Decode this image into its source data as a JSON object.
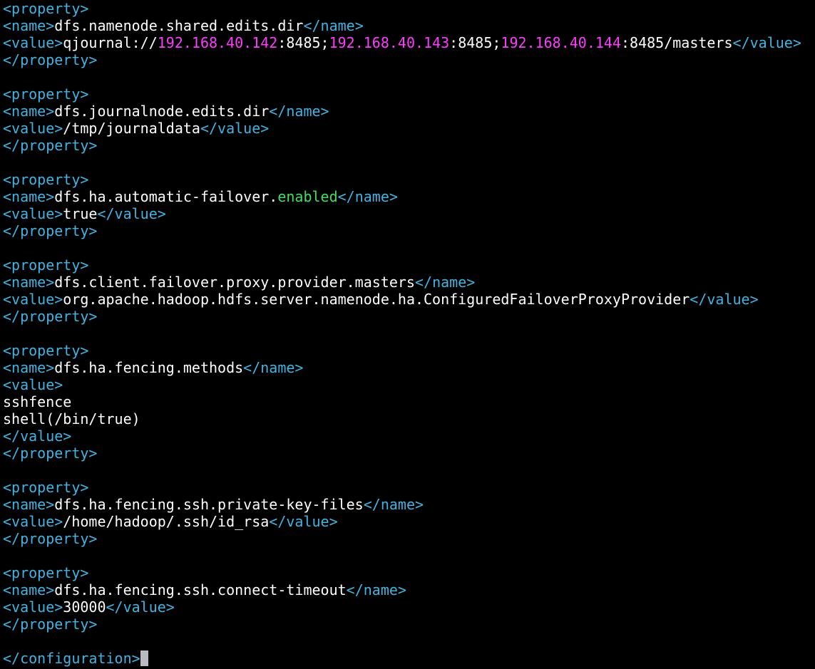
{
  "colors": {
    "background": "#000000",
    "text": "#ffffff",
    "tag": "#3fb4e3",
    "ip": "#ff3bff",
    "keyword": "#3fe05f",
    "cursor": "#b9b9c4"
  },
  "lines": [
    [
      {
        "t": "<property>",
        "k": "tag"
      }
    ],
    [
      {
        "t": "<name>",
        "k": "tag"
      },
      {
        "t": "dfs.namenode.shared.edits.dir",
        "k": "text"
      },
      {
        "t": "</name>",
        "k": "tag"
      }
    ],
    [
      {
        "t": "<value>",
        "k": "tag"
      },
      {
        "t": "qjournal://",
        "k": "text"
      },
      {
        "t": "192.168.40.142",
        "k": "ip"
      },
      {
        "t": ":8485;",
        "k": "text"
      },
      {
        "t": "192.168.40.143",
        "k": "ip"
      },
      {
        "t": ":8485;",
        "k": "text"
      },
      {
        "t": "192.168.40.144",
        "k": "ip"
      },
      {
        "t": ":8485/masters",
        "k": "text"
      },
      {
        "t": "</value>",
        "k": "tag"
      }
    ],
    [
      {
        "t": "</property>",
        "k": "tag"
      }
    ],
    [],
    [
      {
        "t": "<property>",
        "k": "tag"
      }
    ],
    [
      {
        "t": "<name>",
        "k": "tag"
      },
      {
        "t": "dfs.journalnode.edits.dir",
        "k": "text"
      },
      {
        "t": "</name>",
        "k": "tag"
      }
    ],
    [
      {
        "t": "<value>",
        "k": "tag"
      },
      {
        "t": "/tmp/journaldata",
        "k": "text"
      },
      {
        "t": "</value>",
        "k": "tag"
      }
    ],
    [
      {
        "t": "</property>",
        "k": "tag"
      }
    ],
    [],
    [
      {
        "t": "<property>",
        "k": "tag"
      }
    ],
    [
      {
        "t": "<name>",
        "k": "tag"
      },
      {
        "t": "dfs.ha.automatic-failover.",
        "k": "text"
      },
      {
        "t": "enabled",
        "k": "kw"
      },
      {
        "t": "</name>",
        "k": "tag"
      }
    ],
    [
      {
        "t": "<value>",
        "k": "tag"
      },
      {
        "t": "true",
        "k": "text"
      },
      {
        "t": "</value>",
        "k": "tag"
      }
    ],
    [
      {
        "t": "</property>",
        "k": "tag"
      }
    ],
    [],
    [
      {
        "t": "<property>",
        "k": "tag"
      }
    ],
    [
      {
        "t": "<name>",
        "k": "tag"
      },
      {
        "t": "dfs.client.failover.proxy.provider.masters",
        "k": "text"
      },
      {
        "t": "</name>",
        "k": "tag"
      }
    ],
    [
      {
        "t": "<value>",
        "k": "tag"
      },
      {
        "t": "org.apache.hadoop.hdfs.server.namenode.ha.ConfiguredFailoverProxyProvider",
        "k": "text"
      },
      {
        "t": "</value>",
        "k": "tag"
      }
    ],
    [
      {
        "t": "</property>",
        "k": "tag"
      }
    ],
    [],
    [
      {
        "t": "<property>",
        "k": "tag"
      }
    ],
    [
      {
        "t": "<name>",
        "k": "tag"
      },
      {
        "t": "dfs.ha.fencing.methods",
        "k": "text"
      },
      {
        "t": "</name>",
        "k": "tag"
      }
    ],
    [
      {
        "t": "<value>",
        "k": "tag"
      }
    ],
    [
      {
        "t": "sshfence",
        "k": "text"
      }
    ],
    [
      {
        "t": "shell(/bin/true)",
        "k": "text"
      }
    ],
    [
      {
        "t": "</value>",
        "k": "tag"
      }
    ],
    [
      {
        "t": "</property>",
        "k": "tag"
      }
    ],
    [],
    [
      {
        "t": "<property>",
        "k": "tag"
      }
    ],
    [
      {
        "t": "<name>",
        "k": "tag"
      },
      {
        "t": "dfs.ha.fencing.ssh.private-key-files",
        "k": "text"
      },
      {
        "t": "</name>",
        "k": "tag"
      }
    ],
    [
      {
        "t": "<value>",
        "k": "tag"
      },
      {
        "t": "/home/hadoop/.ssh/id_rsa",
        "k": "text"
      },
      {
        "t": "</value>",
        "k": "tag"
      }
    ],
    [
      {
        "t": "</property>",
        "k": "tag"
      }
    ],
    [],
    [
      {
        "t": "<property>",
        "k": "tag"
      }
    ],
    [
      {
        "t": "<name>",
        "k": "tag"
      },
      {
        "t": "dfs.ha.fencing.ssh.connect-timeout",
        "k": "text"
      },
      {
        "t": "</name>",
        "k": "tag"
      }
    ],
    [
      {
        "t": "<value>",
        "k": "tag"
      },
      {
        "t": "30000",
        "k": "text"
      },
      {
        "t": "</value>",
        "k": "tag"
      }
    ],
    [
      {
        "t": "</property>",
        "k": "tag"
      }
    ],
    [],
    [
      {
        "t": "</configuration>",
        "k": "tag"
      }
    ]
  ],
  "cursor_line": 38
}
